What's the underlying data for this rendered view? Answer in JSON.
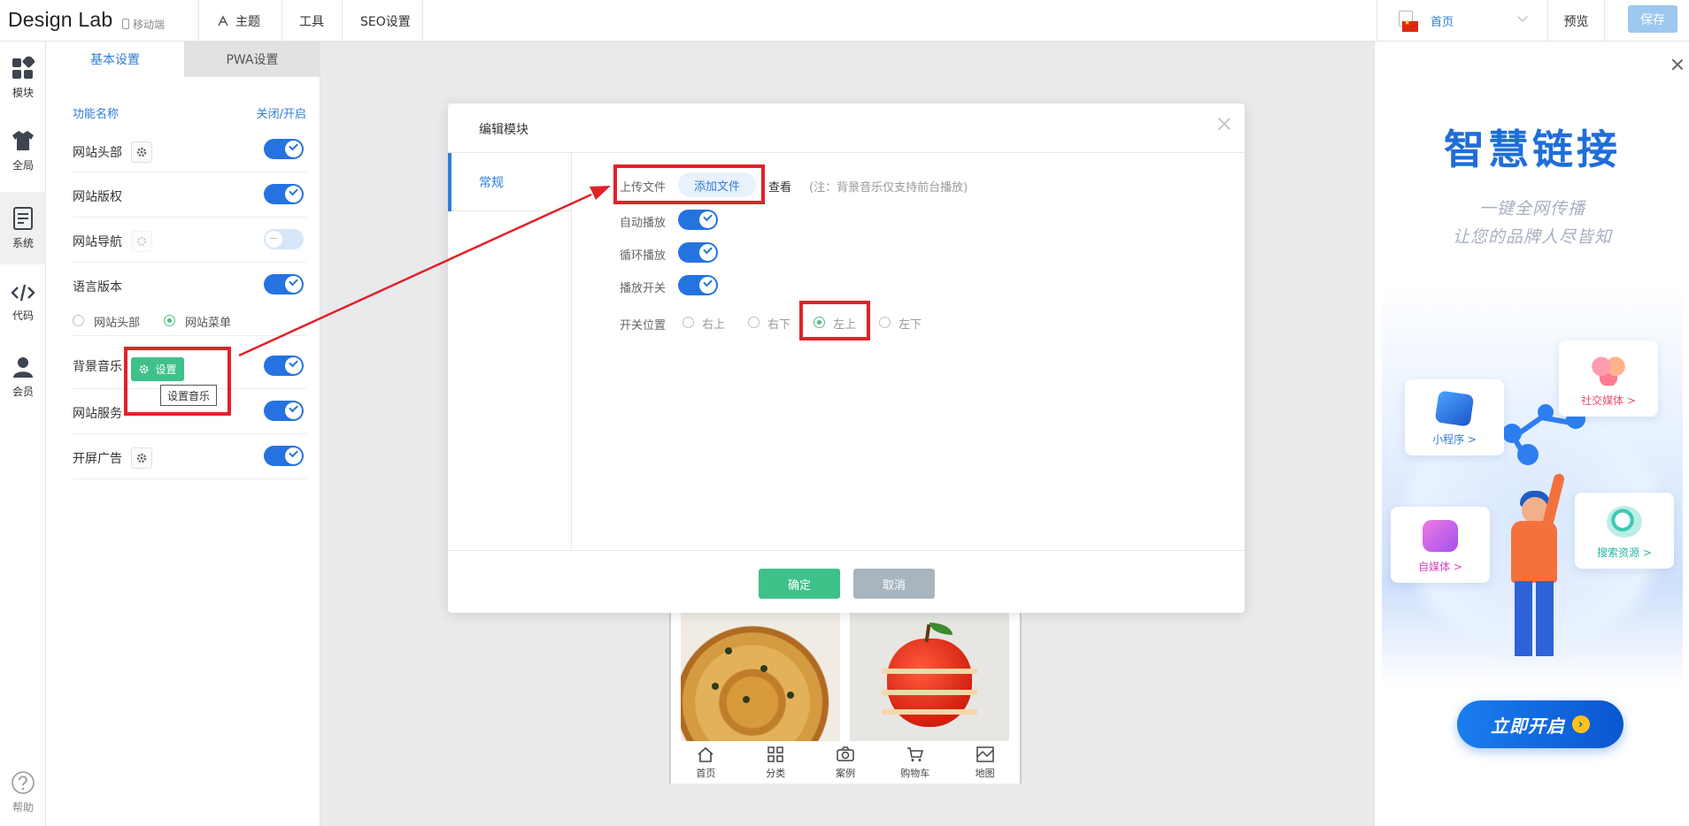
{
  "app": {
    "brand": "Design Lab",
    "mobile_switch": "移动端"
  },
  "topnav": {
    "theme": "主题",
    "tools": "工具",
    "seo": "SEO设置",
    "page_select": "首页",
    "preview": "预览",
    "save": "保存"
  },
  "rail": {
    "items": [
      {
        "label": "模块",
        "icon": "modules-icon"
      },
      {
        "label": "全局",
        "icon": "shirt-icon"
      },
      {
        "label": "系统",
        "icon": "document-icon"
      },
      {
        "label": "代码",
        "icon": "code-icon"
      },
      {
        "label": "会员",
        "icon": "user-icon"
      }
    ],
    "help": "帮助"
  },
  "panel": {
    "tabs": [
      "基本设置",
      "PWA设置"
    ],
    "header_left": "功能名称",
    "header_right": "关闭/开启",
    "rows": [
      {
        "label": "网站头部",
        "enabled": true
      },
      {
        "label": "网站版权",
        "enabled": true
      },
      {
        "label": "网站导航",
        "enabled": false
      },
      {
        "label": "语言版本",
        "enabled": true
      },
      {
        "label": "背景音乐",
        "enabled": true
      },
      {
        "label": "网站服务",
        "enabled": true
      },
      {
        "label": "开屏广告",
        "enabled": true
      }
    ],
    "language_options": [
      "网站头部",
      "网站菜单"
    ],
    "language_selected": "网站菜单",
    "music_set_button": "设置",
    "music_tooltip": "设置音乐"
  },
  "modal": {
    "title": "编辑模块",
    "tab": "常规",
    "upload_label": "上传文件",
    "add_file": "添加文件",
    "view": "查看",
    "note": "(注：背景音乐仅支持前台播放)",
    "autoplay_label": "自动播放",
    "loop_label": "循环播放",
    "switch_label": "播放开关",
    "position_label": "开关位置",
    "positions": [
      "右上",
      "右下",
      "左上",
      "左下"
    ],
    "position_selected": "左上",
    "ok": "确定",
    "cancel": "取消"
  },
  "preview": {
    "tabbar": [
      "首页",
      "分类",
      "案例",
      "购物车",
      "地图"
    ]
  },
  "ad": {
    "title": "智慧链接",
    "sub1": "一键全网传播",
    "sub2": "让您的品牌人尽皆知",
    "cards": [
      "小程序 >",
      "社交媒体 >",
      "自媒体 >",
      "搜索资源 >"
    ],
    "cta": "立即开启"
  },
  "colors": {
    "accent": "#2f7dd6",
    "toggle_on": "#2573e0",
    "confirm_green": "#3fc18a",
    "highlight_red": "#e02229"
  }
}
